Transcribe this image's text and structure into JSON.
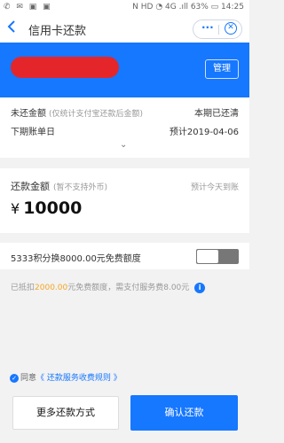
{
  "status_bar": {
    "left_icons": "✆ ✉ ▣ ▣",
    "right": "N HD ◔ 4G .ıll 63% ▭ 14:25"
  },
  "nav": {
    "title": "信用卡还款",
    "back_icon": "chevron-left",
    "more_icon": "more-dots",
    "close_icon": "close-circle",
    "more_glyph": "···",
    "close_glyph": "✕"
  },
  "banner": {
    "manage_label": "管理",
    "card_name_redacted": true
  },
  "bill": {
    "unpaid_label": "未还金额",
    "unpaid_note": "(仅统计支付宝还款后金额)",
    "unpaid_status": "本期已还清",
    "next_bill_label": "下期账单日",
    "next_bill_value": "预计2019-04-06",
    "expand_icon": "chevron-down",
    "expand_glyph": "⌄"
  },
  "repay": {
    "label": "还款金额",
    "note": "(暂不支持外币)",
    "arrival": "预计今天到账",
    "currency": "¥",
    "amount": "10000"
  },
  "points": {
    "text": "5333积分换8000.00元免费额度",
    "toggle_on": false
  },
  "deduction": {
    "prefix": "已抵扣",
    "highlight": "2000.00",
    "suffix": "元免费额度，需支付服务费8.00元",
    "info_icon": "i"
  },
  "agreement": {
    "prefix": "同意",
    "link": "《 还款服务收费规则 》",
    "checked": true
  },
  "actions": {
    "more_label": "更多还款方式",
    "confirm_label": "确认还款"
  },
  "colors": {
    "accent": "#1677ff",
    "highlight": "#f5a623",
    "redact": "#e4262b"
  }
}
